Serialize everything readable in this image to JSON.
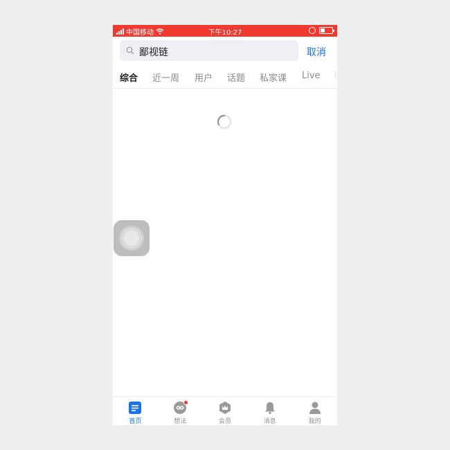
{
  "status_bar": {
    "carrier": "中国移动",
    "time": "下午10:27",
    "battery_level": 0.4,
    "background_color": "#f2392f"
  },
  "search": {
    "query": "鄙视链",
    "cancel_label": "取消",
    "icon": "search-icon"
  },
  "tabs": [
    {
      "label": "综合",
      "active": true
    },
    {
      "label": "近一周",
      "active": false
    },
    {
      "label": "用户",
      "active": false
    },
    {
      "label": "话题",
      "active": false
    },
    {
      "label": "私家课",
      "active": false
    },
    {
      "label": "Live",
      "active": false
    }
  ],
  "content": {
    "state": "loading",
    "spinner_icon": "loading-spinner-icon"
  },
  "assistive_touch": {
    "icon": "assistive-touch-icon"
  },
  "bottom_nav": {
    "accent_color": "#1a73e8",
    "items": [
      {
        "label": "首页",
        "icon": "home-icon",
        "active": true
      },
      {
        "label": "想法",
        "icon": "ideas-icon",
        "active": false,
        "badge": true
      },
      {
        "label": "会员",
        "icon": "membership-icon",
        "active": false
      },
      {
        "label": "消息",
        "icon": "bell-icon",
        "active": false
      },
      {
        "label": "我的",
        "icon": "profile-icon",
        "active": false
      }
    ]
  }
}
